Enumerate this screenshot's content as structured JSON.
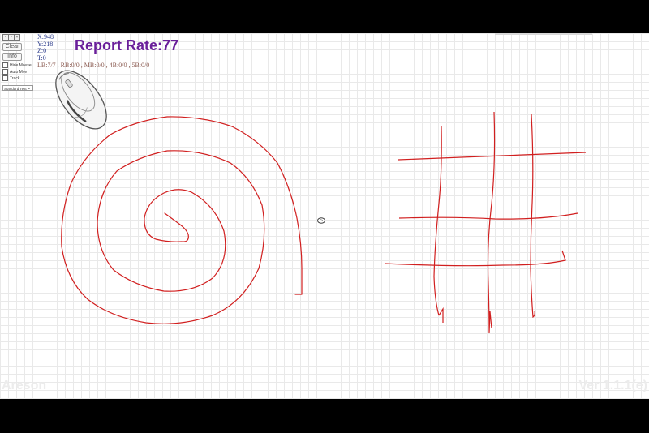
{
  "coordinates": {
    "x": "X:948",
    "y": "Y:218",
    "z": "Z:0",
    "t": "T:0"
  },
  "buttons_status": "LB:7/7 , RB:0/0 , MB:0/0 , 4B:0/0 , 5B:0/0",
  "report_rate": "Report Rate:77",
  "controls": {
    "clear_label": "Clear",
    "info_label": "Info",
    "hide_mouse_label": "Hide Mouse",
    "auto_move_label": "Auto Mve",
    "track_label": "Track",
    "test_mode_selected": "Standard Test"
  },
  "watermark": {
    "brand": "Areson",
    "version": "Ver 1.1.1(e)"
  },
  "colors": {
    "stroke": "#d11f1f",
    "report_rate": "#6a1f9a",
    "coordinates": "#2a3a8a",
    "buttons_status": "#8a5a50"
  },
  "icons": {
    "mouse_illustration": "mouse-icon",
    "cursor": "cursor-icon"
  }
}
